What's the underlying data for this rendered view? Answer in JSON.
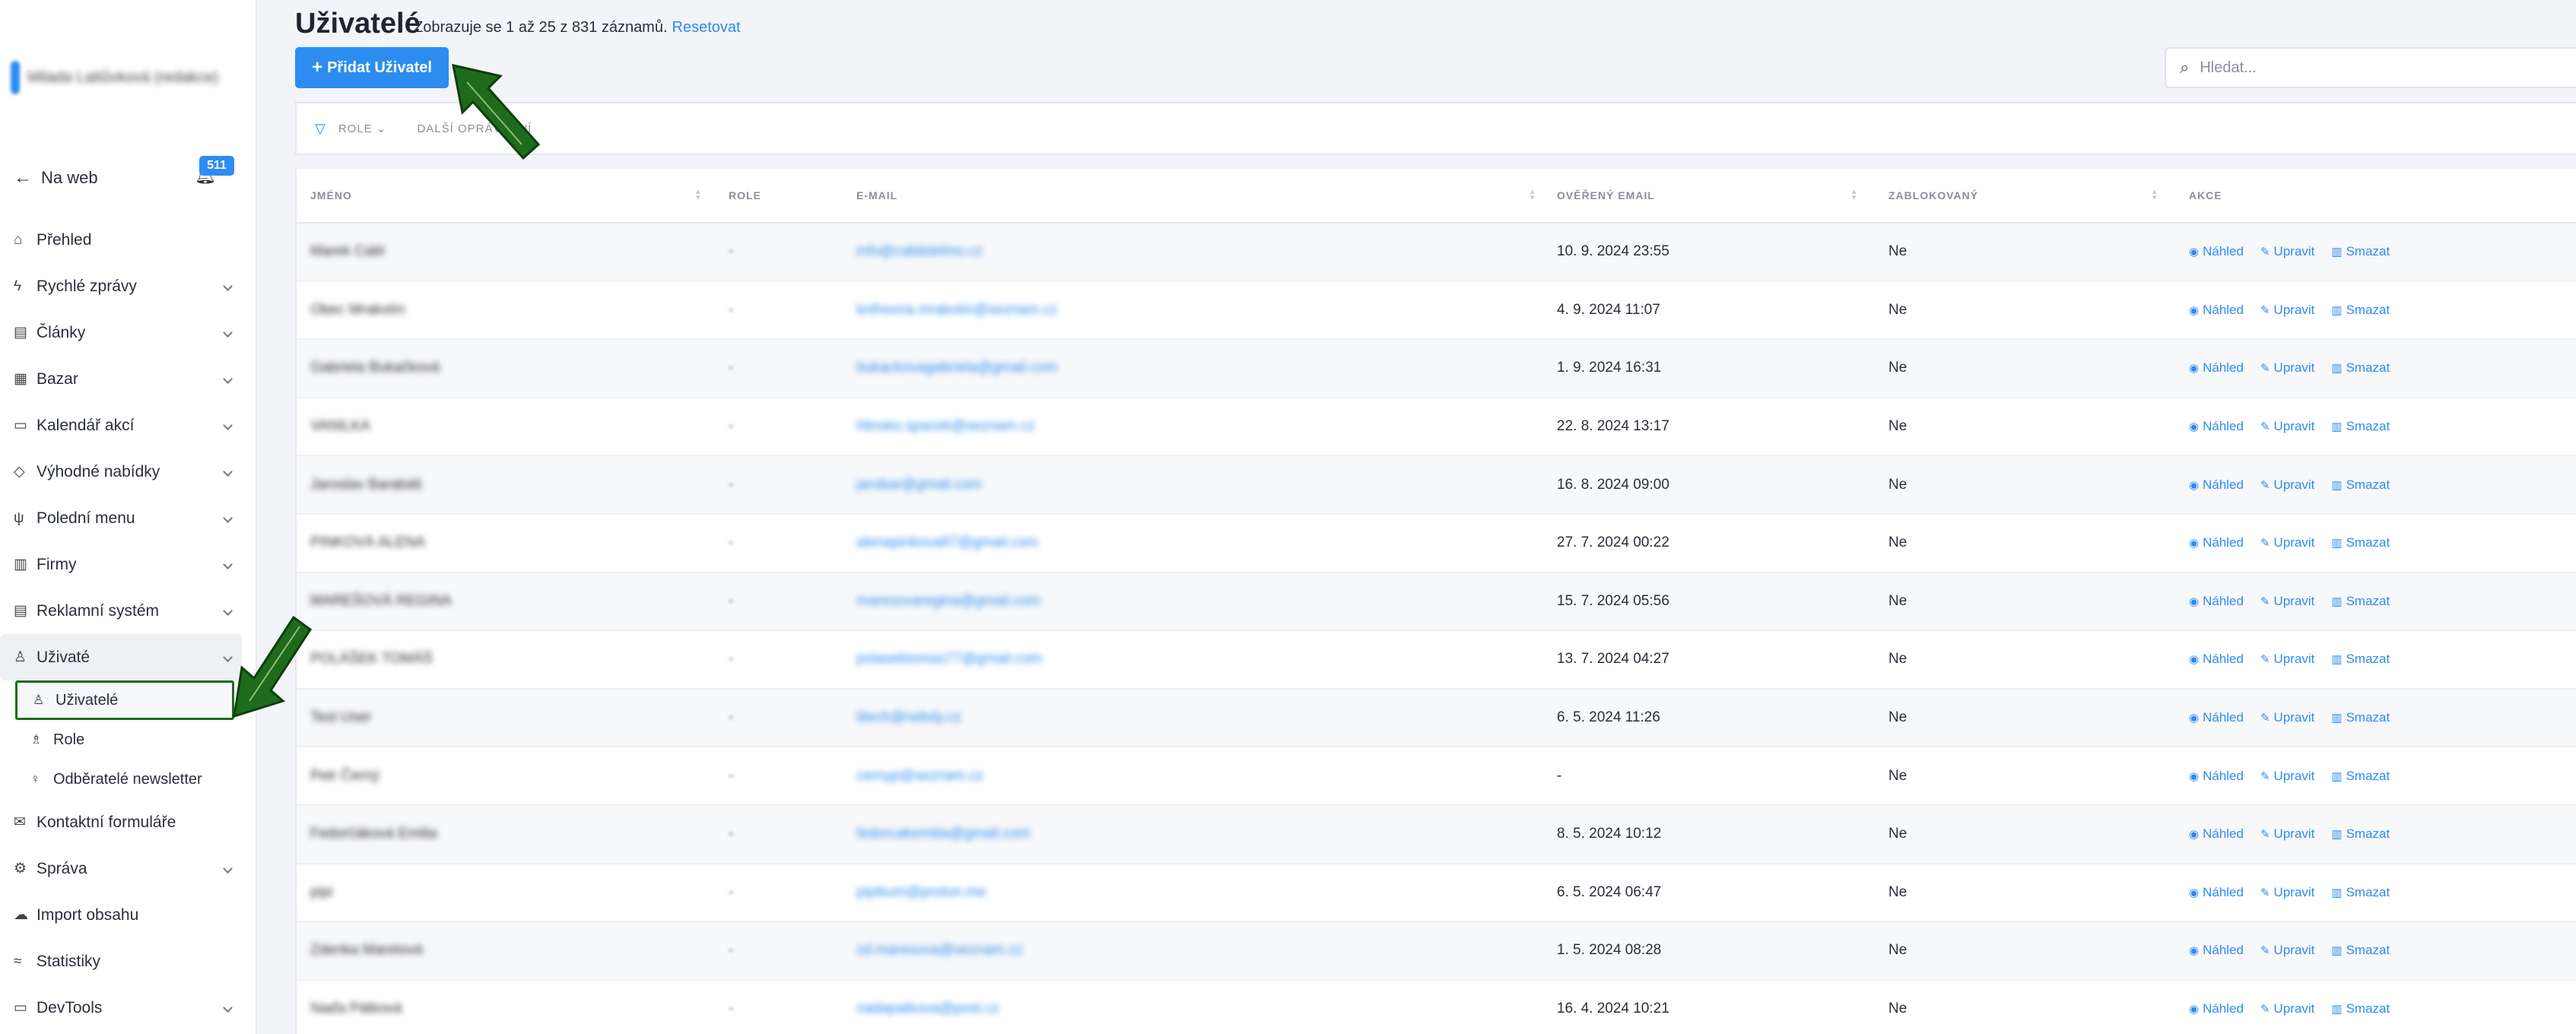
{
  "sidebar": {
    "user_name": "Milada Lattůvková (redakce)",
    "back_label": "Na web",
    "notification_count": "511",
    "items": [
      {
        "label": "Přehled",
        "icon": "home-icon",
        "glyph": "⌂",
        "has_chevron": false
      },
      {
        "label": "Rychlé zprávy",
        "icon": "bolt-icon",
        "glyph": "ϟ",
        "has_chevron": true
      },
      {
        "label": "Články",
        "icon": "book-icon",
        "glyph": "▤",
        "has_chevron": true
      },
      {
        "label": "Bazar",
        "icon": "box-icon",
        "glyph": "▦",
        "has_chevron": true
      },
      {
        "label": "Kalendář akcí",
        "icon": "calendar-icon",
        "glyph": "▭",
        "has_chevron": true
      },
      {
        "label": "Výhodné nabídky",
        "icon": "tag-icon",
        "glyph": "◇",
        "has_chevron": true
      },
      {
        "label": "Polední menu",
        "icon": "cutlery-icon",
        "glyph": "ψ",
        "has_chevron": true
      },
      {
        "label": "Firmy",
        "icon": "building-icon",
        "glyph": "▥",
        "has_chevron": true
      },
      {
        "label": "Reklamní systém",
        "icon": "ad-icon",
        "glyph": "▤",
        "has_chevron": true
      },
      {
        "label": "Uživaté",
        "icon": "user-icon",
        "glyph": "♙",
        "has_chevron": true
      }
    ],
    "sub_items": [
      {
        "label": "Uživatelé",
        "icon": "user-icon",
        "glyph": "♙"
      },
      {
        "label": "Role",
        "icon": "users-icon",
        "glyph": "♗"
      },
      {
        "label": "Odběratelé newsletter",
        "icon": "pin-icon",
        "glyph": "♀"
      }
    ],
    "items_after": [
      {
        "label": "Kontaktní formuláře",
        "icon": "mail-icon",
        "glyph": "✉",
        "has_chevron": false
      },
      {
        "label": "Správa",
        "icon": "settings-icon",
        "glyph": "⚙",
        "has_chevron": true
      },
      {
        "label": "Import obsahu",
        "icon": "cloud-icon",
        "glyph": "☁",
        "has_chevron": false
      },
      {
        "label": "Statistiky",
        "icon": "stats-icon",
        "glyph": "≈",
        "has_chevron": false
      },
      {
        "label": "DevTools",
        "icon": "tools-icon",
        "glyph": "▭",
        "has_chevron": true
      }
    ]
  },
  "header": {
    "title": "Uživatelé",
    "subtitle": "Zobrazuje se 1 až 25 z 831 záznamů.",
    "reset_label": "Resetovat",
    "add_button": "Přidat Uživatel",
    "search_placeholder": "Hledat..."
  },
  "filters": {
    "role": "ROLE",
    "more": "DALŠÍ OPRÁVNĚNÍ"
  },
  "table": {
    "columns": [
      "JMÉNO",
      "ROLE",
      "E-MAIL",
      "OVĚŘENÝ EMAIL",
      "ZABLOKOVANÝ",
      "AKCE"
    ],
    "action_labels": {
      "view": "Náhled",
      "edit": "Upravit",
      "delete": "Smazat"
    },
    "rows": [
      {
        "name": "Marek Cabl",
        "role": "-",
        "email": "info@cabletelmo.cz",
        "verified": "10. 9. 2024 23:55",
        "blocked": "Ne"
      },
      {
        "name": "Obec Mrakotín",
        "role": "-",
        "email": "knihovna.mrakotin@seznam.cz",
        "verified": "4. 9. 2024 11:07",
        "blocked": "Ne"
      },
      {
        "name": "Gabriela Bukačková",
        "role": "-",
        "email": "bukackovagabriela@gmail.com",
        "verified": "1. 9. 2024 16:31",
        "blocked": "Ne"
      },
      {
        "name": "VANILKA",
        "role": "-",
        "email": "hlinsko.spacek@seznam.cz",
        "verified": "22. 8. 2024 13:17",
        "blocked": "Ne"
      },
      {
        "name": "Jaroslav Barabáš",
        "role": "-",
        "email": "jarobar@gmail.com",
        "verified": "16. 8. 2024 09:00",
        "blocked": "Ne"
      },
      {
        "name": "PINKOVÁ ALENA",
        "role": "-",
        "email": "alenapinkova87@gmail.com",
        "verified": "27. 7. 2024 00:22",
        "blocked": "Ne"
      },
      {
        "name": "MAREŠOVÁ REGINA",
        "role": "-",
        "email": "maresovaregina@gmail.com",
        "verified": "15. 7. 2024 05:56",
        "blocked": "Ne"
      },
      {
        "name": "POLÁŠEK TOMÁŠ",
        "role": "-",
        "email": "polasektomas77@gmail.com",
        "verified": "13. 7. 2024 04:27",
        "blocked": "Ne"
      },
      {
        "name": "Test User",
        "role": "-",
        "email": "litech@nebdy.cz",
        "verified": "6. 5. 2024 11:26",
        "blocked": "Ne"
      },
      {
        "name": "Petr Černý",
        "role": "-",
        "email": "cernyp@seznam.cz",
        "verified": "-",
        "blocked": "Ne"
      },
      {
        "name": "Fedorčáková Emilia",
        "role": "-",
        "email": "fedorcakemilia@gmail.com",
        "verified": "8. 5. 2024 10:12",
        "blocked": "Ne"
      },
      {
        "name": "pipi",
        "role": "-",
        "email": "pipikum@proton.me",
        "verified": "6. 5. 2024 06:47",
        "blocked": "Ne"
      },
      {
        "name": "Zdenka Maretová",
        "role": "-",
        "email": "zd.maresova@seznam.cz",
        "verified": "1. 5. 2024 08:28",
        "blocked": "Ne"
      },
      {
        "name": "Naďa Pátková",
        "role": "-",
        "email": "nadapatkova@post.cz",
        "verified": "16. 4. 2024 10:21",
        "blocked": "Ne"
      }
    ]
  },
  "colors": {
    "accent": "#2d8cf0",
    "arrow": "#1e6b1e"
  }
}
